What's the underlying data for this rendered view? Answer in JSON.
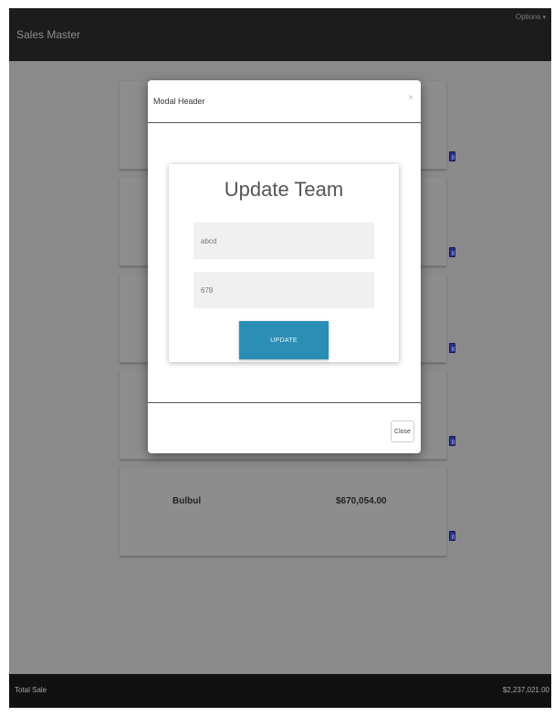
{
  "app": {
    "title": "Sales Master",
    "options_label": "Options"
  },
  "list": {
    "items": [
      {
        "name": "",
        "amount": ""
      },
      {
        "name": "",
        "amount": ""
      },
      {
        "name": "",
        "amount": ""
      },
      {
        "name": "",
        "amount": ""
      },
      {
        "name": "Bulbul",
        "amount": "$670,054.00"
      }
    ]
  },
  "footer": {
    "label": "Total Sale",
    "total": "$2,237,021.00"
  },
  "modal": {
    "header_title": "Modal Header",
    "close_x": "×",
    "form_title": "Update Team",
    "name_value": "abcd",
    "value_value": "678",
    "update_label": "UPDATE",
    "close_label": "Close"
  },
  "colors": {
    "topbar": "#1c1c1c",
    "overlay": "#8a8a8a",
    "footer": "#111111",
    "update_button": "#2b8fb5",
    "delete_icon": "#2a2f8a"
  },
  "icons": {
    "delete": "trash-icon",
    "options_caret": "caret-down-icon"
  }
}
